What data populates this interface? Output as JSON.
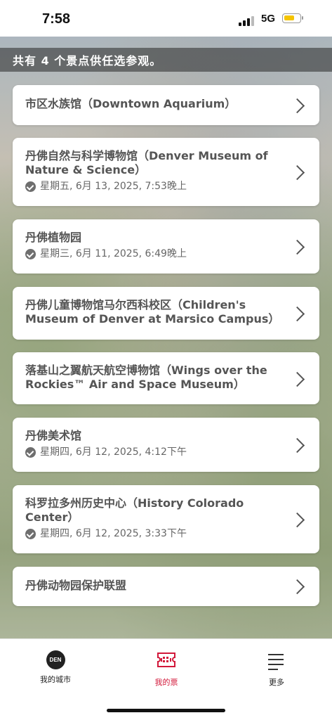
{
  "status": {
    "time": "7:58",
    "network": "5G"
  },
  "header": {
    "text": "共有 4 个景点供任选参观。"
  },
  "attractions": [
    {
      "title": "市区水族馆（Downtown Aquarium）",
      "visited": ""
    },
    {
      "title": "丹佛自然与科学博物馆（Denver Museum of Nature & Science）",
      "visited": "星期五, 6月 13, 2025, 7:53晚上"
    },
    {
      "title": "丹佛植物园",
      "visited": "星期三, 6月 11, 2025, 6:49晚上"
    },
    {
      "title": "丹佛儿童博物馆马尔西科校区（Children's Museum of Denver at Marsico Campus）",
      "visited": ""
    },
    {
      "title": "落基山之翼航天航空博物馆（Wings over the Rockies™ Air and Space Museum）",
      "visited": ""
    },
    {
      "title": "丹佛美术馆",
      "visited": "星期四, 6月 12, 2025, 4:12下午"
    },
    {
      "title": "科罗拉多州历史中心（History Colorado Center）",
      "visited": "星期四, 6月 12, 2025, 3:33下午"
    },
    {
      "title": "丹佛动物园保护联盟",
      "visited": ""
    }
  ],
  "nav": {
    "city_badge": "DEN",
    "my_city": "我的城市",
    "my_tickets": "我的票",
    "more": "更多",
    "active_color": "#d2183a"
  }
}
